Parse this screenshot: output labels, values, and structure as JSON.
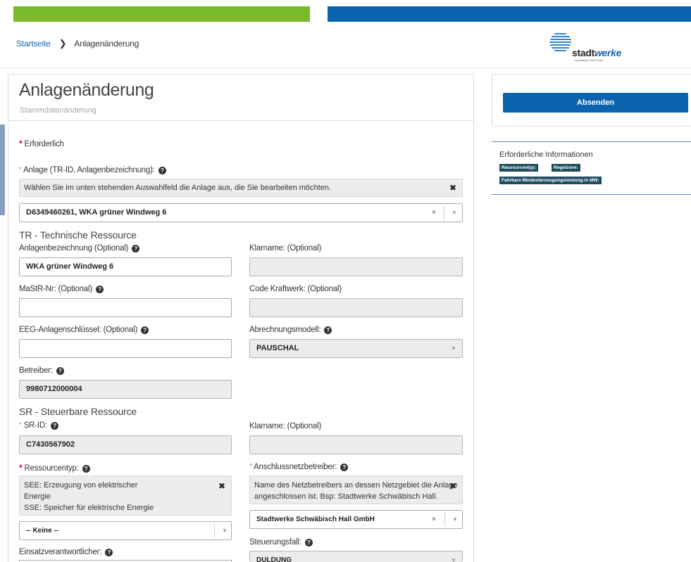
{
  "colors": {
    "green_bar": "#7ab929",
    "blue_bar": "#0b63ad",
    "primary": "#0b63ad",
    "tag": "#1e4e5d",
    "required": "#d0021b"
  },
  "breadcrumb": {
    "home": "Startseite",
    "separator": "❯",
    "current": "Anlagenänderung"
  },
  "logo": {
    "word_plain": "stadt",
    "word_accent": "werke",
    "subline": "Schwäbisch Hall GmbH"
  },
  "form": {
    "title": "Anlagenänderung",
    "subtitle": "Stammdatenänderung",
    "required_note": "Erforderlich",
    "anlage": {
      "label": "Anlage (TR-ID, Anlagenbezeichnung):",
      "hint": "Wählen Sie im unten stehenden Auswahlfeld die Anlage aus, die Sie bearbeiten möchten.",
      "value": "D6349460261, WKA grüner Windweg 6"
    },
    "tr": {
      "section": "TR - Technische Ressource",
      "anlagenbezeichnung_label": "Anlagenbezeichnung (Optional)",
      "anlagenbezeichnung_value": "WKA grüner Windweg 6",
      "klarname_label": "Klarname: (Optional)",
      "klarname_value": "",
      "mastr_label": "MaStR-Nr: (Optional)",
      "mastr_value": "",
      "code_kraftwerk_label": "Code Kraftwerk: (Optional)",
      "code_kraftwerk_value": "",
      "eeg_label": "EEG-Anlagenschlüssel: (Optional)",
      "eeg_value": "",
      "abrechnungsmodell_label": "Abrechnungsmodell:",
      "abrechnungsmodell_value": "PAUSCHAL",
      "betreiber_label": "Betreiber:",
      "betreiber_value": "9980712000004"
    },
    "sr": {
      "section": "SR - Steuerbare Ressource",
      "srid_label": "SR-ID:",
      "srid_value": "C7430567902",
      "klarname_label": "Klarname: (Optional)",
      "klarname_value": "",
      "ressourcentyp_label": "Ressourcentyp:",
      "ressourcentyp_hint": [
        "SEE: Erzeugung von elektrischer",
        "Energie",
        "SSE: Speicher für elektrische Energie"
      ],
      "ressourcentyp_value": "-- Keine --",
      "anschluss_label": "Anschlussnetzbetreiber:",
      "anschluss_hint": [
        "Name des Netzbetreibers an dessen Netzgebiet die Anlage",
        "angeschlossen ist. Bsp: Stadtwerke Schwäbisch Hall."
      ],
      "anschluss_value": "Stadtwerke Schwäbisch Hall GmbH",
      "steuerungsfall_label": "Steuerungsfall:",
      "steuerungsfall_value": "DULDUNG",
      "einsatz_label": "Einsatzverantwortlicher:"
    }
  },
  "sidebar": {
    "submit_label": "Absenden",
    "req_info_title": "Erforderliche Informationen",
    "tags": [
      "Ressourcentyp:",
      "Regelzone:",
      "Fahrbare Mindesterzeugungsleistung in MW:"
    ]
  },
  "icons": {
    "help": "?",
    "close": "✖",
    "clear": "×",
    "dropdown": "▼"
  }
}
